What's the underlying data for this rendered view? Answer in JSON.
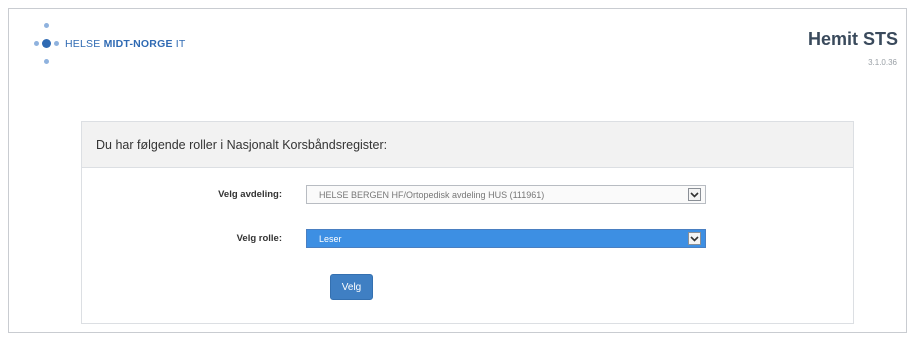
{
  "header": {
    "logo_text_light": "HELSE ",
    "logo_text_bold": "MIDT-NORGE",
    "logo_text_suffix": " IT",
    "app_title": "Hemit STS",
    "version": "3.1.0.36"
  },
  "panel": {
    "heading": "Du har følgende roller i Nasjonalt Korsbåndsregister:"
  },
  "form": {
    "department_label": "Velg avdeling:",
    "department_value": "HELSE BERGEN HF/Ortopedisk avdeling HUS (111961)",
    "role_label": "Velg rolle:",
    "role_value": "Leser",
    "submit_label": "Velg"
  },
  "colors": {
    "brand": "#2f6ab3",
    "button": "#3f7fc3",
    "selected_option": "#3d8fe3"
  },
  "icons": {
    "logo": "helse-midt-norge-dots-icon",
    "select_caret": "chevron-down-icon"
  }
}
